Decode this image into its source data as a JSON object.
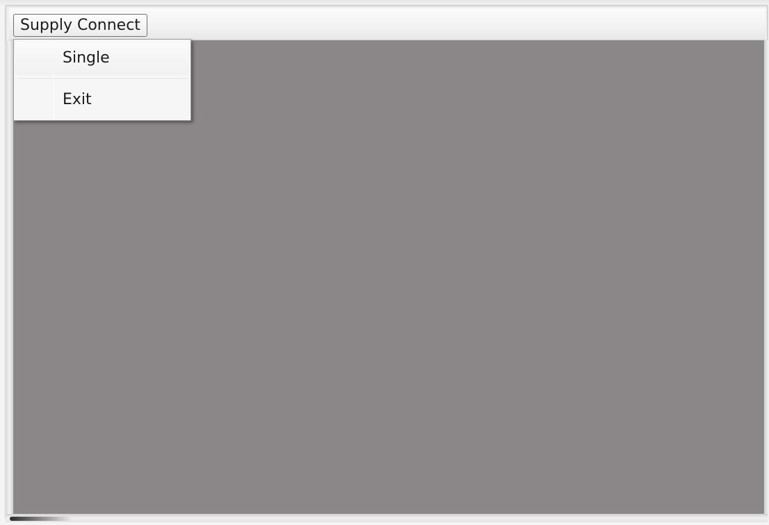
{
  "menubar": {
    "root_menu_label": "Supply Connect"
  },
  "dropdown": {
    "items": [
      {
        "label": "Single"
      },
      {
        "label": "Exit"
      }
    ]
  },
  "colors": {
    "client_area": "#8b8788",
    "menu_background": "#f6f6f6",
    "menubar_background": "#f2f2f2"
  }
}
